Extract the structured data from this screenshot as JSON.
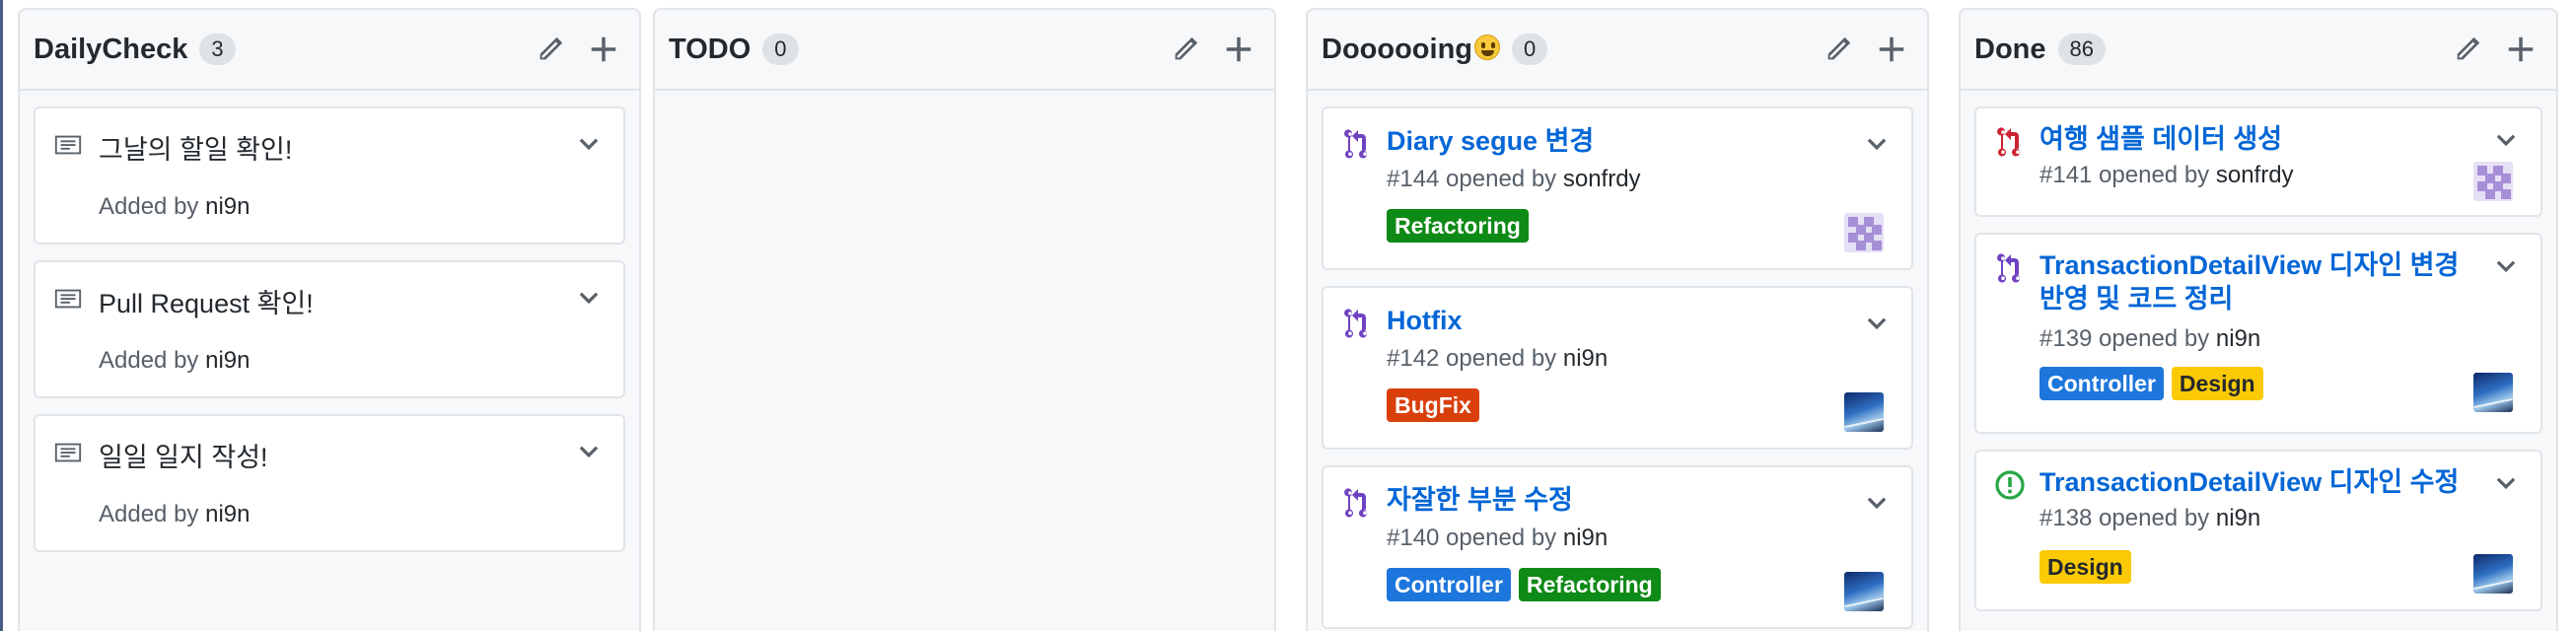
{
  "columns": [
    {
      "title": "DailyCheck",
      "count": "3",
      "cards": [
        {
          "text": "그날의 할일 확인!",
          "added_prefix": "Added by",
          "added_user": "ni9n"
        },
        {
          "text": "Pull Request 확인!",
          "added_prefix": "Added by",
          "added_user": "ni9n"
        },
        {
          "text": "일일 일지 작성!",
          "added_prefix": "Added by",
          "added_user": "ni9n"
        }
      ]
    },
    {
      "title": "TODO",
      "count": "0",
      "cards": []
    },
    {
      "title": "Doooooing",
      "emoji": "grinning-face-emoji",
      "count": "0",
      "cards": [
        {
          "title": "Diary segue 변경",
          "meta_prefix": "#144 opened by",
          "user": "sonfrdy",
          "labels": [
            "Refactoring"
          ],
          "icon": "pull-request-icon",
          "avatar": "pixel"
        },
        {
          "title": "Hotfix",
          "meta_prefix": "#142 opened by",
          "user": "ni9n",
          "labels": [
            "BugFix"
          ],
          "icon": "pull-request-icon",
          "avatar": "sky"
        },
        {
          "title": "자잘한 부분 수정",
          "meta_prefix": "#140 opened by",
          "user": "ni9n",
          "labels": [
            "Controller",
            "Refactoring"
          ],
          "icon": "pull-request-icon",
          "avatar": "sky"
        }
      ]
    },
    {
      "title": "Done",
      "count": "86",
      "cards": [
        {
          "title": "여행 샘플 데이터 생성",
          "meta_prefix": "#141 opened by",
          "user": "sonfrdy",
          "labels": [],
          "icon": "closed-pull-request-icon",
          "avatar": "pixel"
        },
        {
          "title_line1": "TransactionDetailView 디자인 변경",
          "title_line2": "반영 및 코드 정리",
          "meta_prefix": "#139 opened by",
          "user": "ni9n",
          "labels": [
            "Controller",
            "Design"
          ],
          "icon": "pull-request-icon",
          "avatar": "sky"
        },
        {
          "title": "TransactionDetailView 디자인 수정",
          "meta_prefix": "#138 opened by",
          "user": "ni9n",
          "labels": [
            "Design"
          ],
          "icon": "open-issue-icon",
          "avatar": "sky"
        }
      ]
    }
  ],
  "label_colors": {
    "Refactoring": "#0e8a16",
    "BugFix": "#d93f0b",
    "Controller": "#1d76db",
    "Design": "#fbca04"
  },
  "icon_colors": {
    "pull-request-icon": "#6f42c1",
    "closed-pull-request-icon": "#cb2431",
    "open-issue-icon": "#28a745"
  }
}
